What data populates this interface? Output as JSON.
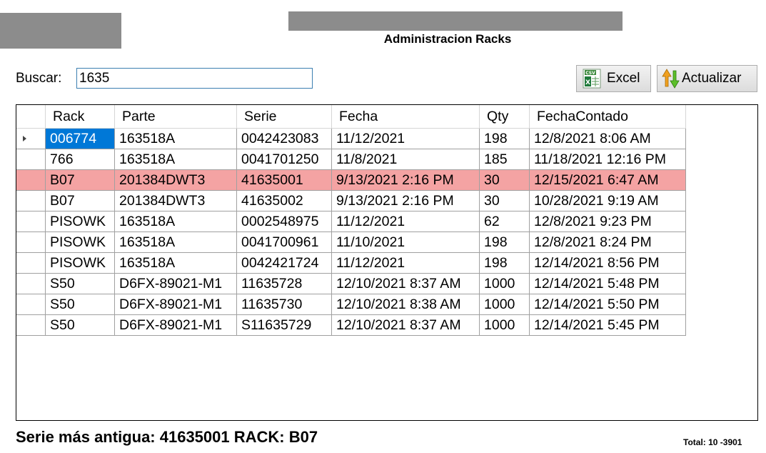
{
  "window": {
    "title": "Administracion Racks"
  },
  "search": {
    "label": "Buscar:",
    "value": "1635"
  },
  "toolbar": {
    "excel_label": "Excel",
    "excel_icon": "csv-excel-icon",
    "refresh_label": "Actualizar",
    "refresh_icon": "up-down-arrows-icon"
  },
  "grid": {
    "columns": [
      "Rack",
      "Parte",
      "Serie",
      "Fecha",
      "Qty",
      "FechaContado"
    ],
    "rows": [
      [
        "006774",
        "163518A",
        "0042423083",
        "11/12/2021",
        "198",
        "12/8/2021 8:06 AM"
      ],
      [
        "766",
        "163518A",
        "0041701250",
        "11/8/2021",
        "185",
        "11/18/2021 12:16 PM"
      ],
      [
        "B07",
        "201384DWT3",
        "41635001",
        "9/13/2021 2:16 PM",
        "30",
        "12/15/2021 6:47 AM"
      ],
      [
        "B07",
        "201384DWT3",
        "41635002",
        "9/13/2021 2:16 PM",
        "30",
        "10/28/2021 9:19 AM"
      ],
      [
        "PISOWK",
        "163518A",
        "0002548975",
        "11/12/2021",
        "62",
        "12/8/2021 9:23 PM"
      ],
      [
        "PISOWK",
        "163518A",
        "0041700961",
        "11/10/2021",
        "198",
        "12/8/2021 8:24 PM"
      ],
      [
        "PISOWK",
        "163518A",
        "0042421724",
        "11/12/2021",
        "198",
        "12/14/2021 8:56 PM"
      ],
      [
        "S50",
        "D6FX-89021-M1",
        "11635728",
        "12/10/2021 8:37 AM",
        "1000",
        "12/14/2021 5:48 PM"
      ],
      [
        "S50",
        "D6FX-89021-M1",
        "11635730",
        "12/10/2021 8:38 AM",
        "1000",
        "12/14/2021 5:50 PM"
      ],
      [
        "S50",
        "D6FX-89021-M1",
        "S11635729",
        "12/10/2021 8:37 AM",
        "1000",
        "12/14/2021 5:45 PM"
      ]
    ],
    "highlight_row": 2,
    "selected_row": 0,
    "highlight_color": "#f4a3a3",
    "selection_color": "#0078d7"
  },
  "footer": {
    "oldest_serial": "Serie más antigua: 41635001 RACK: B07",
    "total": "Total: 10 -3901"
  }
}
